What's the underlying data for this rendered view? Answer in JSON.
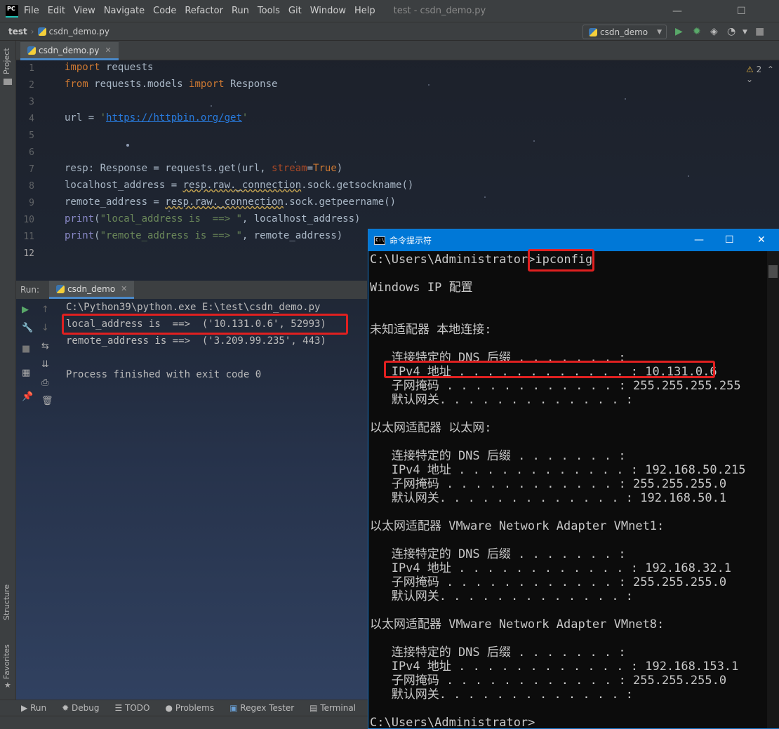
{
  "menubar": {
    "logo": "PC",
    "items": [
      "File",
      "Edit",
      "View",
      "Navigate",
      "Code",
      "Refactor",
      "Run",
      "Tools",
      "Git",
      "Window",
      "Help"
    ],
    "title": "test - csdn_demo.py"
  },
  "navbar": {
    "project": "test",
    "file": "csdn_demo.py",
    "run_config": "csdn_demo"
  },
  "left_tool": {
    "project": "Project",
    "structure": "Structure",
    "favorites": "Favorites"
  },
  "editor": {
    "tab": "csdn_demo.py",
    "warnings": "2",
    "line_numbers": [
      "1",
      "2",
      "3",
      "4",
      "5",
      "6",
      "7",
      "8",
      "9",
      "10",
      "11",
      "12"
    ],
    "lines": {
      "l1_kw": "import",
      " l1_rest": " requests",
      "l2_kw1": "from",
      "l2_mid": " requests.models ",
      "l2_kw2": "import",
      "l2_end": " Response",
      "l4_a": "url = ",
      "l4_q1": "'",
      "l4_url": "https://httpbin.org/get",
      "l4_q2": "'",
      "l7_a": "resp: Response = requests.get(url, ",
      "l7_kw": "stream",
      "l7_eq": "=",
      "l7_true": "True",
      "l7_end": ")",
      "l8_a": "localhost_address = ",
      "l8_w": "resp.raw._connection",
      "l8_b": ".sock.getsockname()",
      "l9_a": "remote_address = ",
      "l9_w": "resp.raw._connection",
      "l9_b": ".sock.getpeername()",
      "l10_fn": "print",
      "l10_a": "(",
      "l10_s": "\"local_address is  ==> \"",
      "l10_b": ", localhost_address)",
      "l11_fn": "print",
      "l11_a": "(",
      "l11_s": "\"remote_address is ==> \"",
      "l11_b": ", remote_address)"
    }
  },
  "run": {
    "label": "Run:",
    "tab": "csdn_demo",
    "output": [
      "C:\\Python39\\python.exe E:\\test\\csdn_demo.py",
      "local_address is  ==>  ('10.131.0.6', 52993)",
      "remote_address is ==>  ('3.209.99.235', 443)",
      "",
      "Process finished with exit code 0"
    ]
  },
  "bottom_tabs": [
    "Run",
    "Debug",
    "TODO",
    "Problems",
    "Regex Tester",
    "Terminal"
  ],
  "cmd": {
    "title": "命令提示符",
    "lines": [
      "C:\\Users\\Administrator>ipconfig",
      "",
      "Windows IP 配置",
      "",
      "",
      "未知适配器 本地连接:",
      "",
      "   连接特定的 DNS 后缀 . . . . . . . :",
      "   IPv4 地址 . . . . . . . . . . . . : 10.131.0.6",
      "   子网掩码 . . . . . . . . . . . . : 255.255.255.255",
      "   默认网关. . . . . . . . . . . . . :",
      "",
      "以太网适配器 以太网:",
      "",
      "   连接特定的 DNS 后缀 . . . . . . . :",
      "   IPv4 地址 . . . . . . . . . . . . : 192.168.50.215",
      "   子网掩码 . . . . . . . . . . . . : 255.255.255.0",
      "   默认网关. . . . . . . . . . . . . : 192.168.50.1",
      "",
      "以太网适配器 VMware Network Adapter VMnet1:",
      "",
      "   连接特定的 DNS 后缀 . . . . . . . :",
      "   IPv4 地址 . . . . . . . . . . . . : 192.168.32.1",
      "   子网掩码 . . . . . . . . . . . . : 255.255.255.0",
      "   默认网关. . . . . . . . . . . . . :",
      "",
      "以太网适配器 VMware Network Adapter VMnet8:",
      "",
      "   连接特定的 DNS 后缀 . . . . . . . :",
      "   IPv4 地址 . . . . . . . . . . . . : 192.168.153.1",
      "   子网掩码 . . . . . . . . . . . . : 255.255.255.0",
      "   默认网关. . . . . . . . . . . . . :",
      "",
      "C:\\Users\\Administrator>"
    ]
  },
  "colors": {
    "highlight": "#e02020",
    "cmd_titlebar": "#0078d7",
    "keyword": "#cc7832",
    "string": "#6a8759"
  }
}
